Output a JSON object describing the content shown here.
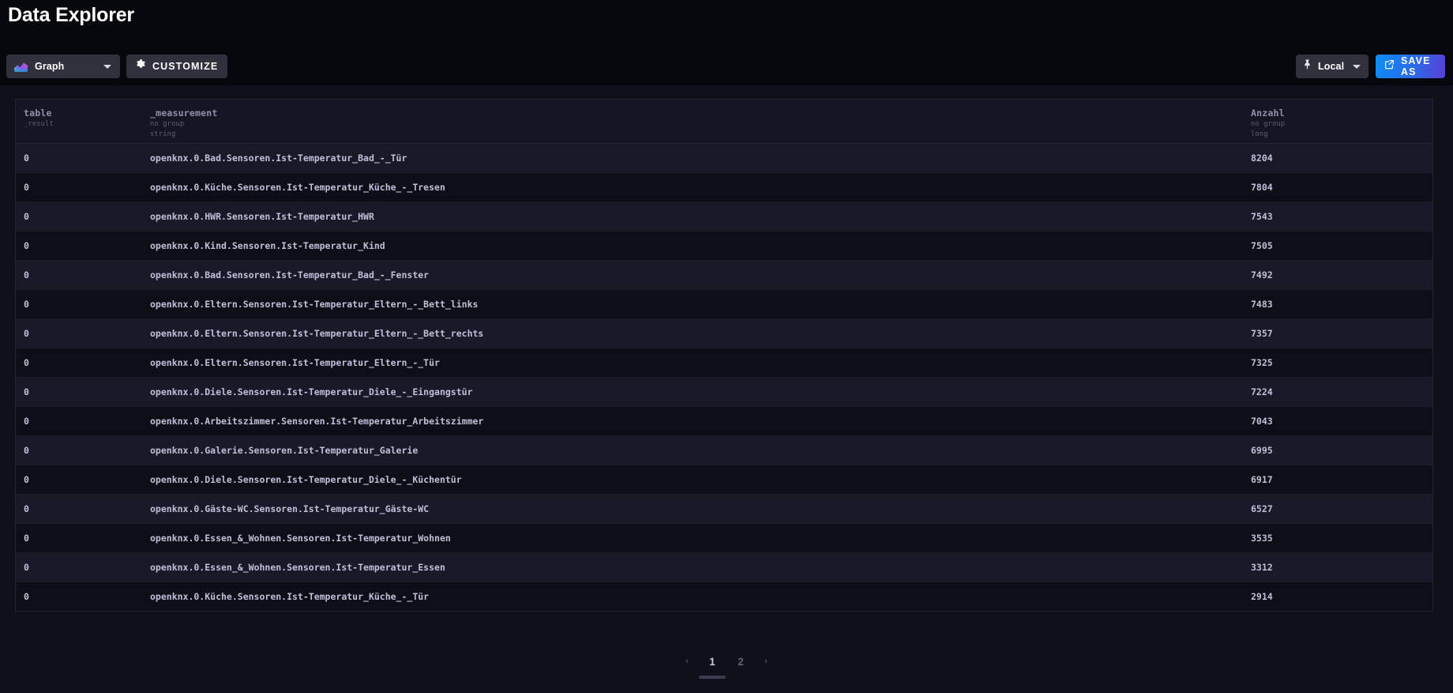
{
  "header": {
    "title": "Data Explorer"
  },
  "toolbar": {
    "visualization": {
      "label": "Graph",
      "icon": "area-chart-icon"
    },
    "customize": {
      "label": "CUSTOMIZE",
      "icon": "gear-icon"
    },
    "local": {
      "label": "Local",
      "icon": "pin-icon"
    },
    "save_as": {
      "label": "SAVE AS",
      "icon": "export-icon"
    },
    "accent_start": "#0f8df5",
    "accent_end": "#5a3fd4"
  },
  "table": {
    "columns": [
      {
        "name": "table",
        "sub1": "_result",
        "sub2": ""
      },
      {
        "name": "_measurement",
        "sub1": "no group",
        "sub2": "string"
      },
      {
        "name": "Anzahl",
        "sub1": "no group",
        "sub2": "long"
      }
    ],
    "rows": [
      {
        "table": "0",
        "measurement": "openknx.0.Bad.Sensoren.Ist-Temperatur_Bad_-_Tür",
        "anzahl": "8204"
      },
      {
        "table": "0",
        "measurement": "openknx.0.Küche.Sensoren.Ist-Temperatur_Küche_-_Tresen",
        "anzahl": "7804"
      },
      {
        "table": "0",
        "measurement": "openknx.0.HWR.Sensoren.Ist-Temperatur_HWR",
        "anzahl": "7543"
      },
      {
        "table": "0",
        "measurement": "openknx.0.Kind.Sensoren.Ist-Temperatur_Kind",
        "anzahl": "7505"
      },
      {
        "table": "0",
        "measurement": "openknx.0.Bad.Sensoren.Ist-Temperatur_Bad_-_Fenster",
        "anzahl": "7492"
      },
      {
        "table": "0",
        "measurement": "openknx.0.Eltern.Sensoren.Ist-Temperatur_Eltern_-_Bett_links",
        "anzahl": "7483"
      },
      {
        "table": "0",
        "measurement": "openknx.0.Eltern.Sensoren.Ist-Temperatur_Eltern_-_Bett_rechts",
        "anzahl": "7357"
      },
      {
        "table": "0",
        "measurement": "openknx.0.Eltern.Sensoren.Ist-Temperatur_Eltern_-_Tür",
        "anzahl": "7325"
      },
      {
        "table": "0",
        "measurement": "openknx.0.Diele.Sensoren.Ist-Temperatur_Diele_-_Eingangstür",
        "anzahl": "7224"
      },
      {
        "table": "0",
        "measurement": "openknx.0.Arbeitszimmer.Sensoren.Ist-Temperatur_Arbeitszimmer",
        "anzahl": "7043"
      },
      {
        "table": "0",
        "measurement": "openknx.0.Galerie.Sensoren.Ist-Temperatur_Galerie",
        "anzahl": "6995"
      },
      {
        "table": "0",
        "measurement": "openknx.0.Diele.Sensoren.Ist-Temperatur_Diele_-_Küchentür",
        "anzahl": "6917"
      },
      {
        "table": "0",
        "measurement": "openknx.0.Gäste-WC.Sensoren.Ist-Temperatur_Gäste-WC",
        "anzahl": "6527"
      },
      {
        "table": "0",
        "measurement": "openknx.0.Essen_&_Wohnen.Sensoren.Ist-Temperatur_Wohnen",
        "anzahl": "3535"
      },
      {
        "table": "0",
        "measurement": "openknx.0.Essen_&_Wohnen.Sensoren.Ist-Temperatur_Essen",
        "anzahl": "3312"
      },
      {
        "table": "0",
        "measurement": "openknx.0.Küche.Sensoren.Ist-Temperatur_Küche_-_Tür",
        "anzahl": "2914"
      }
    ]
  },
  "pagination": {
    "prev": "‹",
    "next": "›",
    "pages": [
      "1",
      "2"
    ],
    "active_page": "1"
  }
}
